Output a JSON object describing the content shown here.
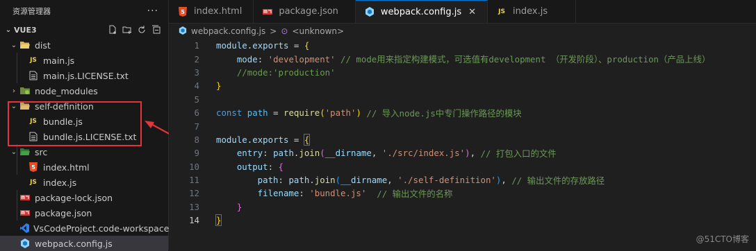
{
  "explorer": {
    "title": "资源管理器",
    "more": "···",
    "project": "VUE3",
    "items": [
      {
        "label": "dist",
        "type": "folder-open"
      },
      {
        "label": "main.js",
        "type": "js"
      },
      {
        "label": "main.js.LICENSE.txt",
        "type": "txt"
      },
      {
        "label": "node_modules",
        "type": "folder-closed"
      },
      {
        "label": "self-definition",
        "type": "folder-open"
      },
      {
        "label": "bundle.js",
        "type": "js"
      },
      {
        "label": "bundle.js.LICENSE.txt",
        "type": "txt"
      },
      {
        "label": "src",
        "type": "folder-open"
      },
      {
        "label": "index.html",
        "type": "html"
      },
      {
        "label": "index.js",
        "type": "js"
      },
      {
        "label": "package-lock.json",
        "type": "json"
      },
      {
        "label": "package.json",
        "type": "json"
      },
      {
        "label": "VsCodeProject.code-workspace",
        "type": "workspace"
      },
      {
        "label": "webpack.config.js",
        "type": "webpack"
      }
    ]
  },
  "tabs": [
    {
      "label": "index.html"
    },
    {
      "label": "package.json"
    },
    {
      "label": "webpack.config.js"
    },
    {
      "label": "index.js"
    }
  ],
  "breadcrumb": {
    "file": "webpack.config.js",
    "sep": ">",
    "symbol": "<unknown>"
  },
  "code": {
    "line_numbers": [
      "1",
      "2",
      "3",
      "4",
      "5",
      "6",
      "7",
      "8",
      "9",
      "10",
      "11",
      "12",
      "13",
      "14"
    ],
    "l1_a": "module",
    "l1_b": ".",
    "l1_c": "exports",
    "l1_d": " = ",
    "l1_e": "{",
    "l2_a": "    mode",
    "l2_b": ": ",
    "l2_c": "'development'",
    "l2_d": " // mode用来指定构建模式，可选值有development （开发阶段）、production（产品上线）",
    "l3_a": "    //mode:'production'",
    "l4_a": "}",
    "l6_a": "const",
    "l6_b": " path",
    "l6_c": " = ",
    "l6_d": "require",
    "l6_e": "(",
    "l6_f": "'path'",
    "l6_g": ")",
    "l6_h": " // 导入node.js中专门操作路径的模块",
    "l8_a": "module",
    "l8_b": ".",
    "l8_c": "exports",
    "l8_d": " = ",
    "l8_e": "{",
    "l9_a": "    entry",
    "l9_b": ": ",
    "l9_c": "path",
    "l9_d": ".",
    "l9_e": "join",
    "l9_f": "(",
    "l9_g": "__dirname",
    "l9_h": ", ",
    "l9_i": "'./src/index.js'",
    "l9_j": ")",
    "l9_k": ",",
    "l9_l": " // 打包入口的文件",
    "l10_a": "    output",
    "l10_b": ": ",
    "l10_c": "{",
    "l11_a": "        path",
    "l11_b": ": ",
    "l11_c": "path",
    "l11_d": ".",
    "l11_e": "join",
    "l11_f": "(",
    "l11_g": "__dirname",
    "l11_h": ", ",
    "l11_i": "'./self-definition'",
    "l11_j": ")",
    "l11_k": ",",
    "l11_l": " // 输出文件的存放路径",
    "l12_a": "        filename",
    "l12_b": ": ",
    "l12_c": "'bundle.js'",
    "l12_d": "  // 输出文件的名称",
    "l13_a": "    }",
    "l14_a": "}"
  },
  "watermark": "@51CTO博客",
  "colors": {
    "accent": "#0078d4",
    "highlight_box": "#e5343a"
  }
}
